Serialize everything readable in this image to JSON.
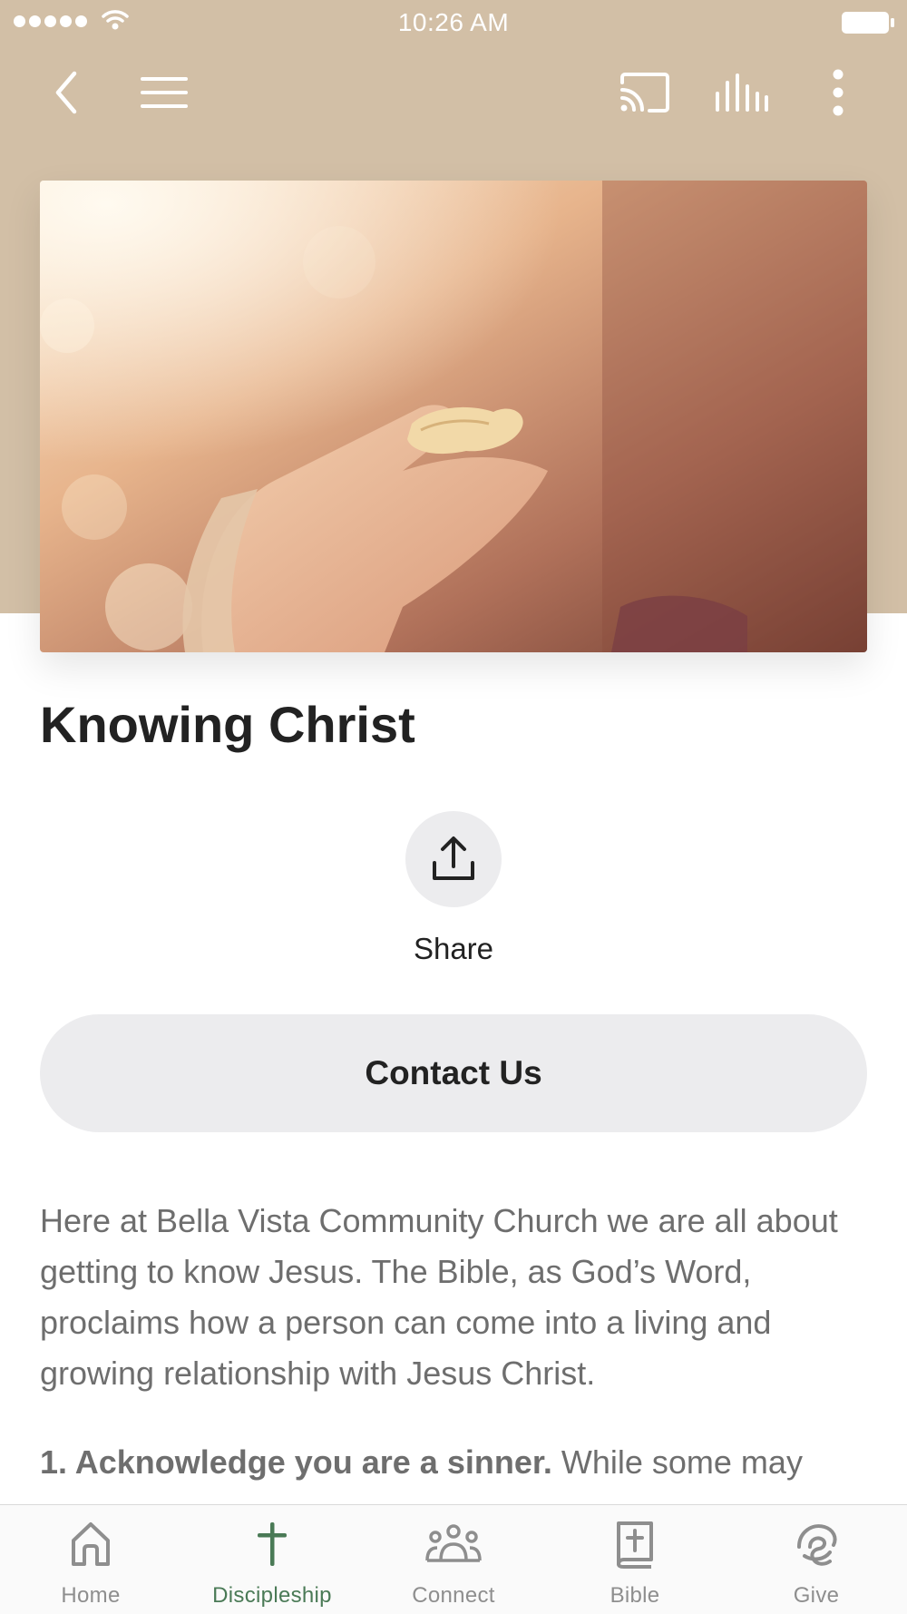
{
  "status_bar": {
    "time": "10:26 AM"
  },
  "page": {
    "title": "Knowing Christ",
    "share_label": "Share",
    "contact_label": "Contact Us",
    "intro": "Here at Bella Vista Community Church we are all about getting to know Jesus. The Bible, as God’s Word, proclaims how a person can come into a living and growing relationship with Jesus Christ.",
    "step1_bold": "1. Acknowledge you are a sinner.",
    "step1_text": " While some may"
  },
  "tabs": [
    {
      "label": "Home",
      "icon": "home-icon"
    },
    {
      "label": "Discipleship",
      "icon": "cross-icon",
      "active": true
    },
    {
      "label": "Connect",
      "icon": "people-icon"
    },
    {
      "label": "Bible",
      "icon": "bible-icon"
    },
    {
      "label": "Give",
      "icon": "give-icon"
    }
  ],
  "colors": {
    "header_background": "#d2bfa6",
    "active_tab": "#4a7a56",
    "inactive_tab": "#8e8e8e",
    "button_background": "#ececee"
  }
}
